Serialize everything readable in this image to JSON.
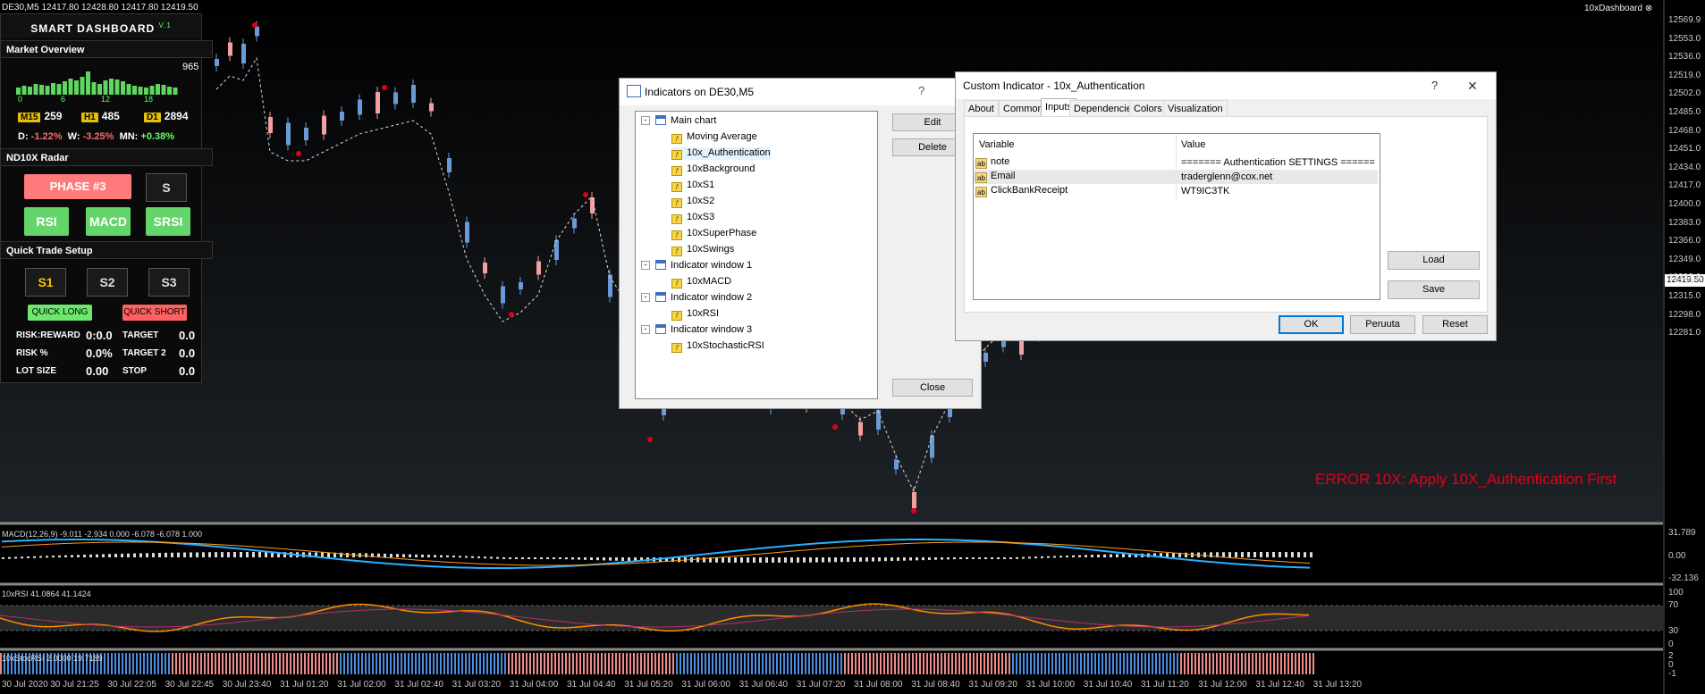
{
  "chart": {
    "symbol_line": "DE30,M5  12417.80 12428.80 12417.80 12419.50",
    "top_right_label": "10xDashboard",
    "error_message": "ERROR 10X: Apply 10X_Authentication First",
    "current_price": "12419.50",
    "price_ticks": [
      "12569.9",
      "12553.0",
      "12536.0",
      "12519.0",
      "12502.0",
      "12485.0",
      "12468.0",
      "12451.0",
      "12434.0",
      "12417.0",
      "12400.0",
      "12383.0",
      "12366.0",
      "12349.0",
      "12332.0",
      "12315.0",
      "12298.0",
      "12281.0"
    ],
    "time_ticks": [
      "30 Jul 2020",
      "30 Jul 21:25",
      "30 Jul 22:05",
      "30 Jul 22:45",
      "30 Jul 23:40",
      "31 Jul 01:20",
      "31 Jul 02:00",
      "31 Jul 02:40",
      "31 Jul 03:20",
      "31 Jul 04:00",
      "31 Jul 04:40",
      "31 Jul 05:20",
      "31 Jul 06:00",
      "31 Jul 06:40",
      "31 Jul 07:20",
      "31 Jul 08:00",
      "31 Jul 08:40",
      "31 Jul 09:20",
      "31 Jul 10:00",
      "31 Jul 10:40",
      "31 Jul 11:20",
      "31 Jul 12:00",
      "31 Jul 12:40",
      "31 Jul 13:20"
    ],
    "macd_label": "MACD(12,26,9) -9.011 -2.934 0.000 -6.078 -6.078 1.000",
    "macd_ticks": [
      "31.789",
      "0.00",
      "-32.136"
    ],
    "rsi_label": "10xRSI 41.0864 41.1424",
    "rsi_ticks": [
      "100",
      "70",
      "30",
      "0"
    ],
    "srsi_label": "10xStocRSI 2.0000 19.7189",
    "srsi_ticks": [
      "2",
      "0",
      "-1"
    ],
    "colors": {
      "bull": "#6b9bd6",
      "bear": "#f0a0a0",
      "accent_red": "#e0001b"
    }
  },
  "dashboard": {
    "title": "SMART DASHBOARD",
    "version": "V.1",
    "market_overview": "Market Overview",
    "bar_max": "965",
    "bar_axis": [
      "0",
      "6",
      "12",
      "18"
    ],
    "tf": [
      {
        "label": "M15",
        "value": "259"
      },
      {
        "label": "H1",
        "value": "485"
      },
      {
        "label": "D1",
        "value": "2894"
      }
    ],
    "changes": {
      "d_label": "D:",
      "d": "-1.22%",
      "w_label": "W:",
      "w": "-3.25%",
      "mn_label": "MN:",
      "mn": "+0.38%"
    },
    "radar": "ND10X Radar",
    "phase": "PHASE #3",
    "s_btn": "S",
    "rsi_btn": "RSI",
    "macd_btn": "MACD",
    "srsi_btn": "SRSI",
    "quick_trade": "Quick Trade Setup",
    "s1": "S1",
    "s2": "S2",
    "s3": "S3",
    "quick_long": "QUICK LONG",
    "quick_short": "QUICK SHORT",
    "rows": [
      {
        "l1": "RISK:REWARD",
        "v1": "0:0.0",
        "l2": "TARGET",
        "v2": "0.0"
      },
      {
        "l1": "RISK %",
        "v1": "0.0%",
        "l2": "TARGET 2",
        "v2": "0.0"
      },
      {
        "l1": "LOT SIZE",
        "v1": "0.00",
        "l2": "STOP",
        "v2": "0.0"
      }
    ]
  },
  "indicators_dialog": {
    "title": "Indicators on DE30,M5",
    "help": "?",
    "tree": [
      {
        "label": "Main chart",
        "type": "win",
        "level": 0
      },
      {
        "label": "Moving Average",
        "type": "ind",
        "level": 1
      },
      {
        "label": "10x_Authentication",
        "type": "ind",
        "level": 1
      },
      {
        "label": "10xBackground",
        "type": "ind",
        "level": 1
      },
      {
        "label": "10xS1",
        "type": "ind",
        "level": 1
      },
      {
        "label": "10xS2",
        "type": "ind",
        "level": 1
      },
      {
        "label": "10xS3",
        "type": "ind",
        "level": 1
      },
      {
        "label": "10xSuperPhase",
        "type": "ind",
        "level": 1
      },
      {
        "label": "10xSwings",
        "type": "ind",
        "level": 1
      },
      {
        "label": "Indicator window 1",
        "type": "win",
        "level": 0
      },
      {
        "label": "10xMACD",
        "type": "ind",
        "level": 1
      },
      {
        "label": "Indicator window 2",
        "type": "win",
        "level": 0
      },
      {
        "label": "10xRSI",
        "type": "ind",
        "level": 1
      },
      {
        "label": "Indicator window 3",
        "type": "win",
        "level": 0
      },
      {
        "label": "10xStochasticRSI",
        "type": "ind",
        "level": 1
      }
    ],
    "edit": "Edit",
    "delete": "Delete",
    "close": "Close"
  },
  "custom_dialog": {
    "title": "Custom Indicator - 10x_Authentication",
    "help": "?",
    "close_x": "✕",
    "tabs": [
      "About",
      "Common",
      "Inputs",
      "Dependencies",
      "Colors",
      "Visualization"
    ],
    "active_tab": "Inputs",
    "col_variable": "Variable",
    "col_value": "Value",
    "rows": [
      {
        "var": "note",
        "val": "======= Authentication SETTINGS ======"
      },
      {
        "var": "Email",
        "val": "traderglenn@cox.net"
      },
      {
        "var": "ClickBankReceipt",
        "val": "WT9IC3TK"
      }
    ],
    "load": "Load",
    "save": "Save",
    "ok": "OK",
    "cancel": "Peruuta",
    "reset": "Reset"
  }
}
